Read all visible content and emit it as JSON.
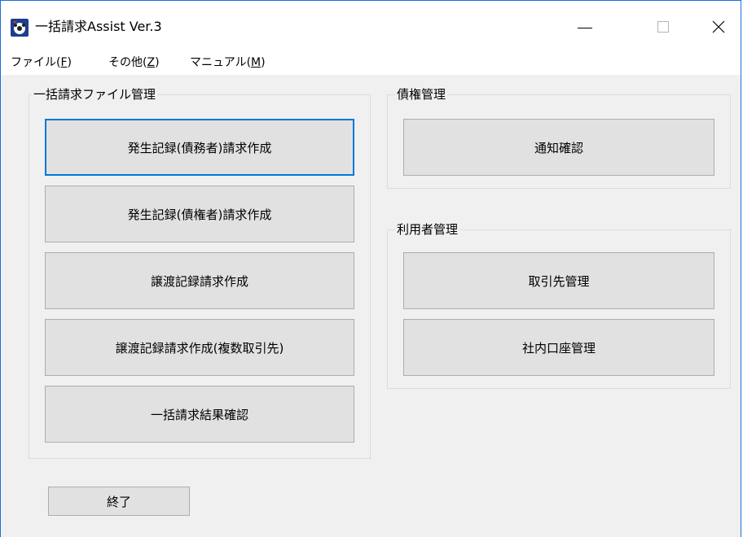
{
  "window": {
    "title": "一括請求Assist Ver.3",
    "controls": {
      "minimize_glyph": "—",
      "close_glyph": "✕"
    }
  },
  "menubar": {
    "file": {
      "label": "ファイル(",
      "key": "F",
      "tail": ")"
    },
    "other": {
      "label": "その他(",
      "key": "Z",
      "tail": ")"
    },
    "manual": {
      "label": "マニュアル(",
      "key": "M",
      "tail": ")"
    }
  },
  "batch_group": {
    "title": "一括請求ファイル管理",
    "buttons": {
      "debtor": "発生記録(債務者)請求作成",
      "creditor": "発生記録(債権者)請求作成",
      "transfer": "譲渡記録請求作成",
      "transfer_multi": "譲渡記録請求作成(複数取引先)",
      "result": "一括請求結果確認"
    }
  },
  "claims_group": {
    "title": "債権管理",
    "buttons": {
      "notice": "通知確認"
    }
  },
  "user_group": {
    "title": "利用者管理",
    "buttons": {
      "partner": "取引先管理",
      "account": "社内口座管理"
    }
  },
  "exit_button": "終了",
  "colors": {
    "accent": "#0078d7",
    "window_border": "#1c6fd6",
    "button_face": "#e1e1e1",
    "background": "#f0f0f0"
  }
}
